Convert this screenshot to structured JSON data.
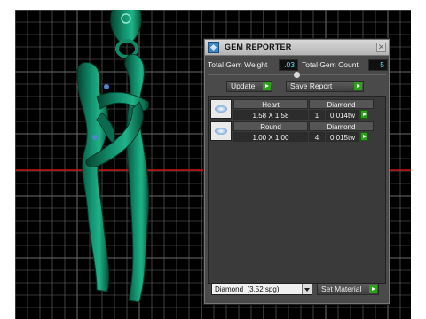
{
  "panel": {
    "title": "GEM REPORTER",
    "close_glyph": "✕",
    "total_weight_label": "Total Gem Weight",
    "total_weight_value": ".03",
    "total_count_label": "Total Gem Count",
    "total_count_value": "5",
    "update_label": "Update",
    "save_report_label": "Save Report",
    "gems": [
      {
        "shape": "Heart",
        "material": "Diamond",
        "size": "1.58 X 1.58",
        "count": "1",
        "weight": "0.014tw"
      },
      {
        "shape": "Round",
        "material": "Diamond",
        "size": "1.00 X 1.00",
        "count": "4",
        "weight": "0.015tw"
      }
    ],
    "material_select": "Diamond  (3.52 spg)",
    "set_material_label": "Set Material"
  },
  "colors": {
    "model": "#0e7a5c",
    "highlight": "#3bd0a0",
    "axis_red": "#cc1111",
    "grid": "#6b6b6b",
    "value_text": "#5fe3ff",
    "go_arrow": "#2da11c"
  },
  "icons": {
    "title": "gem-reporter-icon",
    "close": "close-icon",
    "go": "play-arrow-icon",
    "gem_preview": "gem-thumbnail-icon",
    "dropdown": "chevron-down-icon"
  }
}
